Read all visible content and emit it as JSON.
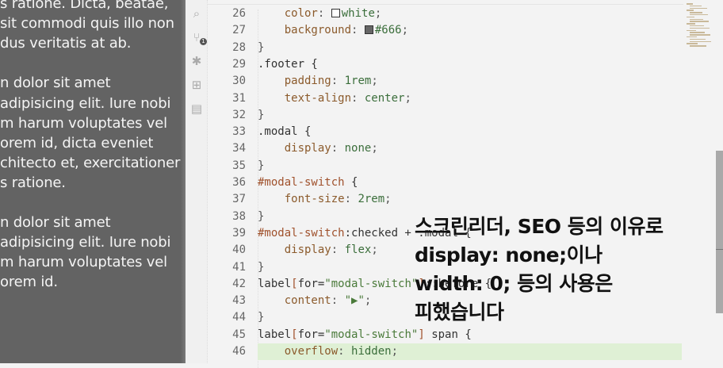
{
  "preview": {
    "lines": [
      "s ratione. Dicta, beatae,",
      "sit commodi quis illo non",
      "dus veritatis at ab.",
      "",
      "n dolor sit amet",
      " adipisicing elit. Iure nobi",
      "m harum voluptates vel",
      "orem id, dicta eveniet",
      "chitecto et, exercitationer",
      "s ratione.",
      "",
      "n dolor sit amet",
      " adipisicing elit. Iure nobi",
      "m harum voluptates vel",
      "orem id."
    ]
  },
  "activity_bar": {
    "items": [
      "search-icon",
      "source-control-icon",
      "debug-icon",
      "extensions-icon",
      "document-icon"
    ],
    "source_control_badge": "1"
  },
  "editor": {
    "swatches": {
      "white": "#ffffff",
      "666": "#666666"
    },
    "highlight_line": 46,
    "lines": [
      {
        "n": "26",
        "t": [
          [
            "    ",
            ""
          ],
          [
            "color",
            "prop"
          ],
          [
            ": ",
            "punc"
          ],
          [
            "SW:white",
            ""
          ],
          [
            "white",
            "val"
          ],
          [
            ";",
            "punc"
          ]
        ]
      },
      {
        "n": "27",
        "t": [
          [
            "    ",
            ""
          ],
          [
            "background",
            "prop"
          ],
          [
            ": ",
            "punc"
          ],
          [
            "SW:666",
            ""
          ],
          [
            "#666",
            "val"
          ],
          [
            ";",
            "punc"
          ]
        ]
      },
      {
        "n": "28",
        "t": [
          [
            "}",
            "punc"
          ]
        ]
      },
      {
        "n": "29",
        "t": [
          [
            ".footer {",
            "sel"
          ]
        ]
      },
      {
        "n": "30",
        "t": [
          [
            "    ",
            ""
          ],
          [
            "padding",
            "prop"
          ],
          [
            ": ",
            "punc"
          ],
          [
            "1rem",
            "val"
          ],
          [
            ";",
            "punc"
          ]
        ]
      },
      {
        "n": "31",
        "t": [
          [
            "    ",
            ""
          ],
          [
            "text-align",
            "prop"
          ],
          [
            ": ",
            "punc"
          ],
          [
            "center",
            "val"
          ],
          [
            ";",
            "punc"
          ]
        ]
      },
      {
        "n": "32",
        "t": [
          [
            "}",
            "punc"
          ]
        ]
      },
      {
        "n": "33",
        "t": [
          [
            ".modal {",
            "sel"
          ]
        ]
      },
      {
        "n": "34",
        "t": [
          [
            "    ",
            ""
          ],
          [
            "display",
            "prop"
          ],
          [
            ": ",
            "punc"
          ],
          [
            "none",
            "val"
          ],
          [
            ";",
            "punc"
          ]
        ]
      },
      {
        "n": "35",
        "t": [
          [
            "}",
            "punc"
          ]
        ]
      },
      {
        "n": "36",
        "t": [
          [
            "#modal-switch",
            "brk"
          ],
          [
            " {",
            "sel"
          ]
        ]
      },
      {
        "n": "37",
        "t": [
          [
            "    ",
            ""
          ],
          [
            "font-size",
            "prop"
          ],
          [
            ": ",
            "punc"
          ],
          [
            "2rem",
            "val"
          ],
          [
            ";",
            "punc"
          ]
        ]
      },
      {
        "n": "38",
        "t": [
          [
            "}",
            "punc"
          ]
        ]
      },
      {
        "n": "39",
        "t": [
          [
            "#modal-switch",
            "brk"
          ],
          [
            ":checked + .modal {",
            "sel"
          ]
        ]
      },
      {
        "n": "40",
        "t": [
          [
            "    ",
            ""
          ],
          [
            "display",
            "prop"
          ],
          [
            ": ",
            "punc"
          ],
          [
            "flex",
            "val"
          ],
          [
            ";",
            "punc"
          ]
        ]
      },
      {
        "n": "41",
        "t": [
          [
            "}",
            "punc"
          ]
        ]
      },
      {
        "n": "42",
        "t": [
          [
            "label",
            "sel"
          ],
          [
            "[",
            "brk"
          ],
          [
            "for=",
            "sel"
          ],
          [
            "\"modal-switch\"",
            "str"
          ],
          [
            "]",
            "brk"
          ],
          [
            "::before {",
            "sel"
          ]
        ]
      },
      {
        "n": "43",
        "t": [
          [
            "    ",
            ""
          ],
          [
            "content",
            "prop"
          ],
          [
            ": ",
            "punc"
          ],
          [
            "\"▶\"",
            "str"
          ],
          [
            ";",
            "punc"
          ]
        ]
      },
      {
        "n": "44",
        "t": [
          [
            "}",
            "punc"
          ]
        ]
      },
      {
        "n": "45",
        "t": [
          [
            "label",
            "sel"
          ],
          [
            "[",
            "brk"
          ],
          [
            "for=",
            "sel"
          ],
          [
            "\"modal-switch\"",
            "str"
          ],
          [
            "]",
            "brk"
          ],
          [
            " span {",
            "sel"
          ]
        ]
      },
      {
        "n": "46",
        "t": [
          [
            "    ",
            ""
          ],
          [
            "overflow",
            "prop"
          ],
          [
            ": ",
            "punc"
          ],
          [
            "hidden",
            "val"
          ],
          [
            ";",
            "punc"
          ]
        ]
      }
    ]
  },
  "caption": {
    "lines": [
      "스크린리더, SEO 등의 이유로",
      "display: none;이나",
      "width: 0; 등의 사용은",
      "피했습니다"
    ]
  }
}
